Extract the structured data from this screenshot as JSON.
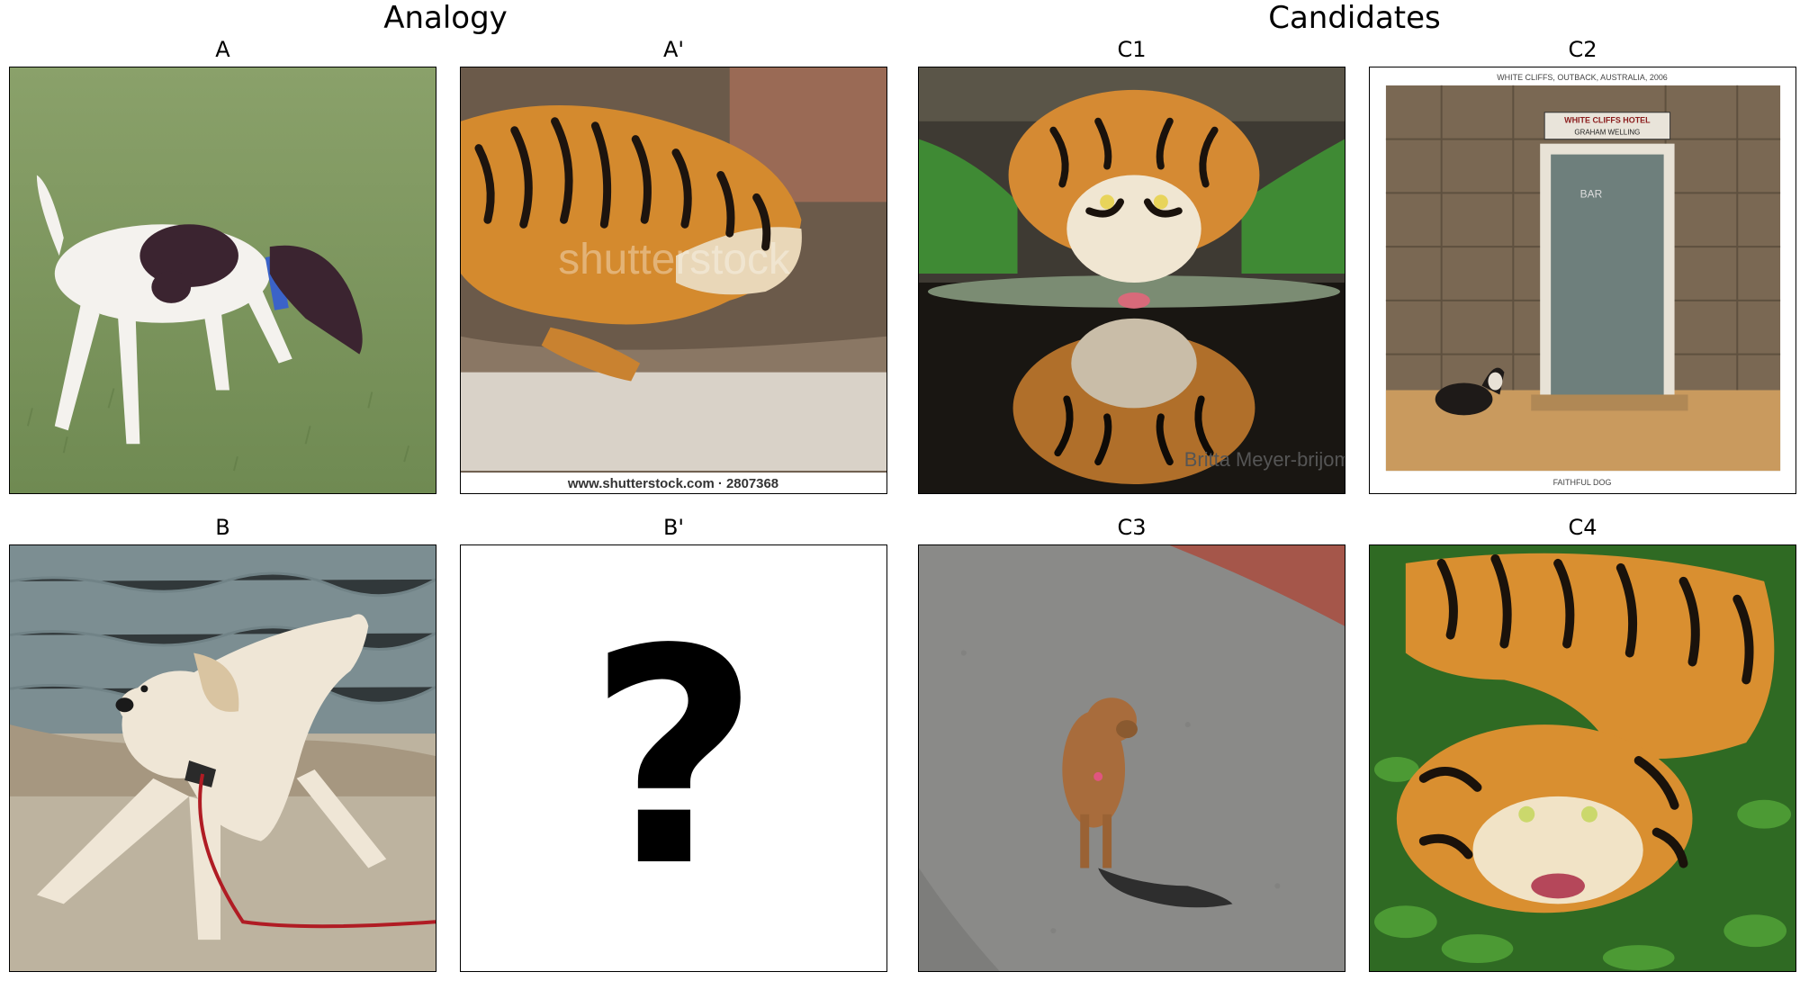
{
  "headers": {
    "analogy": "Analogy",
    "candidates": "Candidates"
  },
  "panels": {
    "a": {
      "label": "A",
      "content": "dog-image"
    },
    "a2": {
      "label": "A'",
      "content": "tiger-image",
      "watermark_top": "shutterstock",
      "watermark": "www.shutterstock.com · 2807368"
    },
    "b": {
      "label": "B",
      "content": "dog-image"
    },
    "b2": {
      "label": "B'",
      "content": "question-mark",
      "symbol": "?"
    },
    "c1": {
      "label": "C1",
      "content": "tiger-image",
      "signature": "Britta Meyer-brijome"
    },
    "c2": {
      "label": "C2",
      "content": "dog-image",
      "caption_top": "WHITE CLIFFS, OUTBACK, AUSTRALIA, 2006",
      "sign_line1": "WHITE CLIFFS HOTEL",
      "sign_line2": "GRAHAM WELLING",
      "door_text": "BAR",
      "caption_bottom": "FAITHFUL DOG"
    },
    "c3": {
      "label": "C3",
      "content": "dog-image"
    },
    "c4": {
      "label": "C4",
      "content": "tiger-image"
    }
  }
}
